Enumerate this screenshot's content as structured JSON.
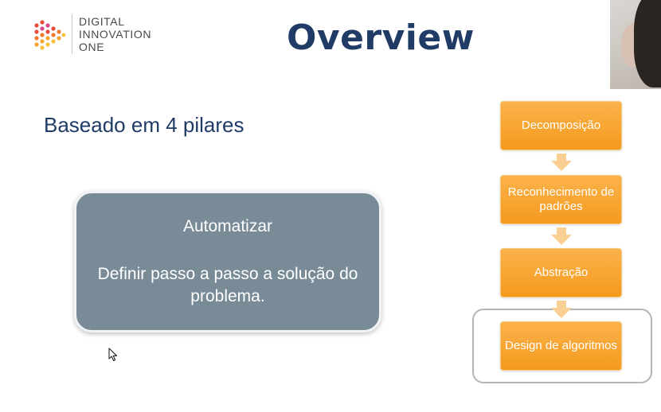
{
  "logo": {
    "lines": [
      "DIGITAL",
      "INNOVATION",
      "ONE"
    ]
  },
  "slide": {
    "title": "Overview",
    "subtitle": "Baseado em 4 pilares"
  },
  "card": {
    "heading": "Automatizar",
    "body": "Definir passo a passo a solução do problema."
  },
  "flow": {
    "steps": [
      "Decomposição",
      "Reconhecimento de padrões",
      "Abstração",
      "Design de algoritmos"
    ]
  },
  "colors": {
    "title": "#1f3b66",
    "card": "#7a8b98",
    "flow_box": "#f7a531",
    "arrow": "#f9cf93"
  },
  "icons": {
    "cursor": "mouse-pointer-icon",
    "logo": "digital-innovation-one-logo"
  }
}
